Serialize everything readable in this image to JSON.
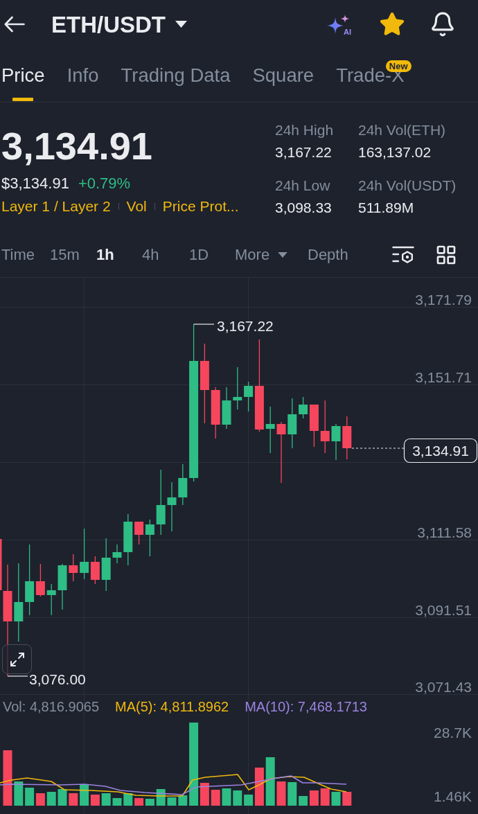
{
  "header": {
    "title": "ETH/USDT",
    "ai_label": "AI",
    "favorite": true
  },
  "tabs": [
    {
      "label": "Price",
      "selected": true
    },
    {
      "label": "Info",
      "selected": false
    },
    {
      "label": "Trading Data",
      "selected": false
    },
    {
      "label": "Square",
      "selected": false
    },
    {
      "label": "Trade-X",
      "selected": false,
      "badge": "New"
    }
  ],
  "ticker": {
    "last_price": "3,134.91",
    "usd_price": "$3,134.91",
    "change": "+0.79%",
    "tags": [
      "Layer 1 / Layer 2",
      "Vol",
      "Price Prot..."
    ],
    "stats": [
      {
        "label": "24h High",
        "value": "3,167.22"
      },
      {
        "label": "24h Vol(ETH)",
        "value": "163,137.02"
      },
      {
        "label": "24h Low",
        "value": "3,098.33"
      },
      {
        "label": "24h Vol(USDT)",
        "value": "511.89M"
      }
    ]
  },
  "intervals": [
    {
      "label": "Time",
      "kind": "option",
      "selected": false
    },
    {
      "label": "15m",
      "kind": "option",
      "selected": false
    },
    {
      "label": "1h",
      "kind": "option",
      "selected": true
    },
    {
      "label": "4h",
      "kind": "option",
      "selected": false
    },
    {
      "label": "1D",
      "kind": "option",
      "selected": false
    },
    {
      "label": "More",
      "kind": "dropdown",
      "selected": false
    },
    {
      "label": "Depth",
      "kind": "option",
      "selected": false
    }
  ],
  "chart": {
    "price_axis": [
      "3,171.79",
      "3,151.71",
      "3,111.58",
      "3,091.51",
      "3,071.43"
    ],
    "high_label": "3,167.22",
    "low_label": "3,076.00",
    "last_price_tag": "3,134.91",
    "volume_legend": [
      {
        "label": "Vol: 4,816.9065",
        "color": "#848e9c"
      },
      {
        "label": "MA(5): 4,811.8962",
        "color": "#f0b90b"
      },
      {
        "label": "MA(10): 7,468.1713",
        "color": "#9b84e0"
      }
    ],
    "volume_axis": [
      "28.7K",
      "1.46K"
    ]
  }
}
